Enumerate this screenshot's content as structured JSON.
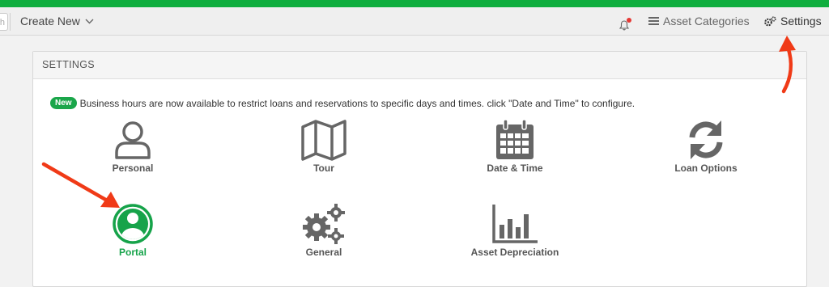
{
  "topbar": {
    "search_stub": "ch",
    "create_new": "Create New",
    "asset_categories": "Asset Categories",
    "settings": "Settings"
  },
  "panel": {
    "title": "SETTINGS",
    "notice_badge": "New",
    "notice_text": "Business hours are now available to restrict loans and reservations to specific days and times. click \"Date and Time\" to configure."
  },
  "tiles": [
    {
      "label": "Personal",
      "icon": "user-icon"
    },
    {
      "label": "Tour",
      "icon": "map-icon"
    },
    {
      "label": "Date & Time",
      "icon": "calendar-icon"
    },
    {
      "label": "Loan Options",
      "icon": "refresh-icon"
    },
    {
      "label": "Portal",
      "icon": "user-circle-icon",
      "active": true
    },
    {
      "label": "General",
      "icon": "gears-icon"
    },
    {
      "label": "Asset Depreciation",
      "icon": "bar-chart-icon"
    }
  ],
  "colors": {
    "accent_green": "#0fae3e",
    "active_green": "#16a34a",
    "annotation_red": "#f03a17",
    "icon_gray": "#666666"
  }
}
